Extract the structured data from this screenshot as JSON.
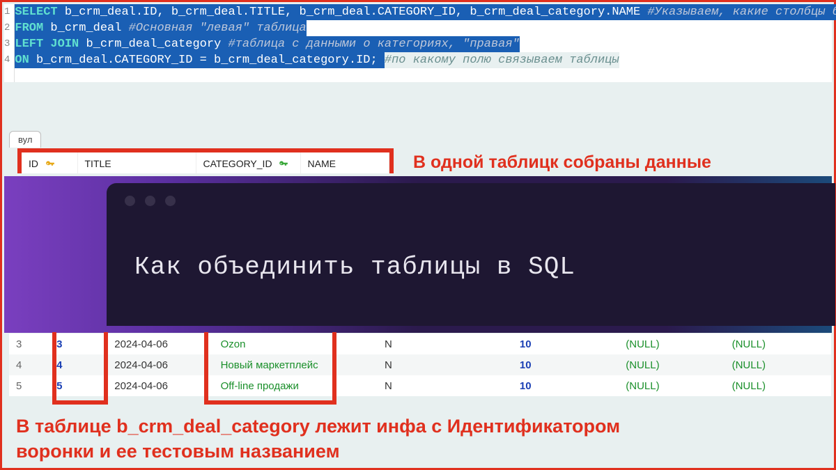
{
  "sql": {
    "lines": [
      "1",
      "2",
      "3",
      "4"
    ],
    "l1": {
      "kw": "SELECT ",
      "cols": "b_crm_deal.ID, b_crm_deal.TITLE, b_crm_deal.CATEGORY_ID, b_crm_deal_category.NAME ",
      "cmnt": "#Указываем, какие столбцы брат"
    },
    "l2": {
      "kw": "FROM ",
      "tbl": "b_crm_deal ",
      "cmnt": "#Основная \"левая\" таблица"
    },
    "l3": {
      "kw": "LEFT JOIN ",
      "tbl": "b_crm_deal_category ",
      "cmnt": "#таблица с данными о категориях, \"правая\""
    },
    "l4": {
      "kw": "ON ",
      "expr": "b_crm_deal.CATEGORY_ID = b_crm_deal_category.ID; ",
      "cmnt": "#по какому полю связываем таблицы"
    }
  },
  "tab_partial": "вул",
  "result_header": {
    "cols": [
      "ID",
      "TITLE",
      "CATEGORY_ID",
      "NAME"
    ]
  },
  "anno_top": "В одной таблицк собраны данные",
  "card": {
    "title": "Как объединить таблицы в SQL"
  },
  "lower_table": {
    "rows": [
      {
        "n": "3",
        "id": "3",
        "date": "2024-04-06",
        "name": "Ozon",
        "flag": "N",
        "ten": "10",
        "null1": "(NULL)",
        "null2": "(NULL)"
      },
      {
        "n": "4",
        "id": "4",
        "date": "2024-04-06",
        "name": "Новый маркетплейс",
        "flag": "N",
        "ten": "10",
        "null1": "(NULL)",
        "null2": "(NULL)"
      },
      {
        "n": "5",
        "id": "5",
        "date": "2024-04-06",
        "name": "Off-line продажи",
        "flag": "N",
        "ten": "10",
        "null1": "(NULL)",
        "null2": "(NULL)"
      }
    ]
  },
  "anno_bottom_l1": "В таблице b_crm_deal_category лежит инфа с Идентификатором",
  "anno_bottom_l2": "воронки и ее тестовым названием"
}
